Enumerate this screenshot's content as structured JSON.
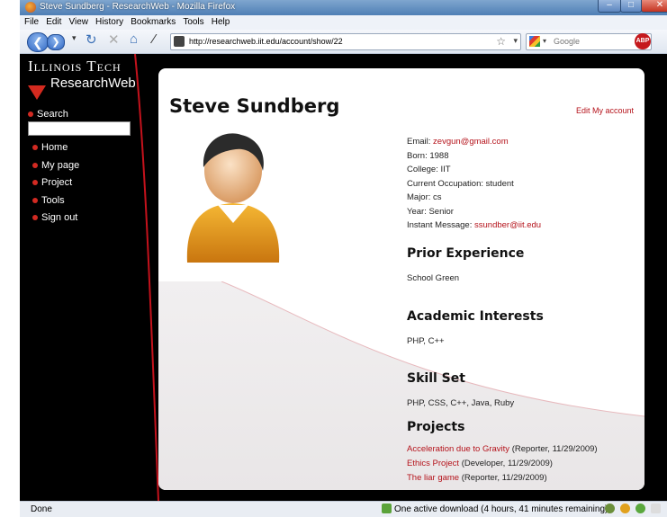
{
  "window": {
    "title": "Steve Sundberg - ResearchWeb - Mozilla Firefox",
    "controls": [
      "–",
      "□",
      "✕"
    ]
  },
  "menu": [
    "File",
    "Edit",
    "View",
    "History",
    "Bookmarks",
    "Tools",
    "Help"
  ],
  "toolbar": {
    "url": "http://researchweb.iit.edu/account/show/22",
    "search_placeholder": "Google",
    "abp_label": "ABP"
  },
  "sidebar": {
    "brand_top": "Illinois Tech",
    "brand_bottom": "ResearchWeb",
    "search_label": "Search",
    "search_value": "",
    "nav": [
      "Home",
      "My page",
      "Project",
      "Tools",
      "Sign out"
    ]
  },
  "profile": {
    "name": "Steve Sundberg",
    "edit_link": "Edit My account",
    "email_label": "Email:",
    "email": "zevgun@gmail.com",
    "born": "Born: 1988",
    "college": "College: IIT",
    "occupation": "Current Occupation: student",
    "major": "Major: cs",
    "year": "Year: Senior",
    "im_label": "Instant Message:",
    "im": "ssundber@iit.edu"
  },
  "sections": {
    "prior_title": "Prior Experience",
    "prior_text": "School Green",
    "academic_title": "Academic Interests",
    "academic_text": "PHP, C++",
    "skill_title": "Skill Set",
    "skill_text": "PHP, CSS, C++, Java, Ruby",
    "projects_title": "Projects"
  },
  "projects": [
    {
      "title": "Acceleration due to Gravity",
      "meta": " (Reporter, 11/29/2009)"
    },
    {
      "title": "Ethics Project",
      "meta": " (Developer, 11/29/2009)"
    },
    {
      "title": "The liar game",
      "meta": " (Reporter, 11/29/2009)"
    }
  ],
  "status": {
    "left": "Done",
    "download": "One active download (4 hours, 41 minutes remaining)"
  },
  "colors": {
    "accent_red": "#b5131b",
    "sidebar_bg": "#000000",
    "titlebar_blue": "#4f7fb5"
  }
}
